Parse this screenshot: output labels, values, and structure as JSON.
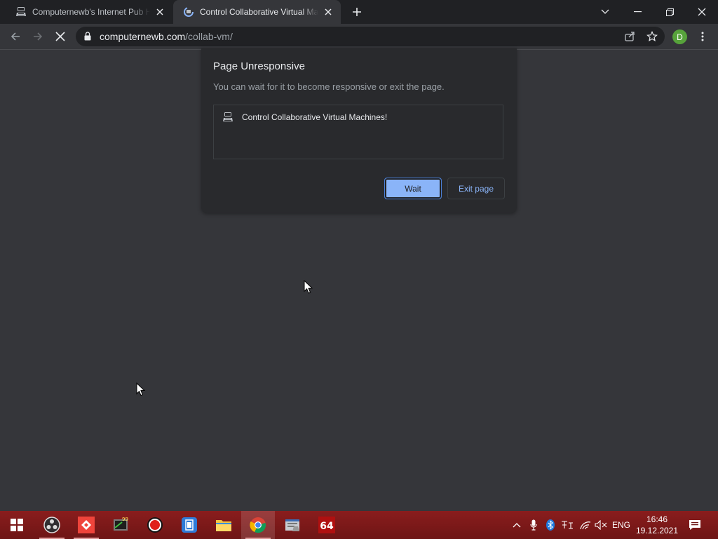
{
  "browser": {
    "tabs": [
      {
        "title": "Computernewb's Internet Pub Hub",
        "favicon": "computernewb-logo-icon",
        "active": false
      },
      {
        "title": "Control Collaborative Virtual Machines!",
        "favicon": "loading-spinner-icon",
        "active": true
      }
    ],
    "url_host": "computernewb.com",
    "url_path": "/collab-vm/",
    "profile_initial": "D",
    "colors": {
      "tabstrip": "#202124",
      "toolbar": "#35363a",
      "accent": "#8ab4f8",
      "profile": "#57a33b"
    }
  },
  "dialog": {
    "title": "Page Unresponsive",
    "message": "You can wait for it to become responsive or exit the page.",
    "pages": [
      {
        "title": "Control Collaborative Virtual Machines!",
        "favicon": "computernewb-logo-icon"
      }
    ],
    "wait_label": "Wait",
    "exit_label": "Exit page"
  },
  "taskbar": {
    "apps": [
      "windows-start-icon",
      "obs-studio-icon",
      "anydesk-icon",
      "notes-app-icon",
      "record-icon",
      "video-editor-icon",
      "file-explorer-icon",
      "chrome-icon",
      "app-window-icon",
      "aida64-icon"
    ],
    "aida_label": "64",
    "language": "ENG",
    "time": "16:46",
    "date": "19.12.2021",
    "color": "#7a1a1a"
  }
}
